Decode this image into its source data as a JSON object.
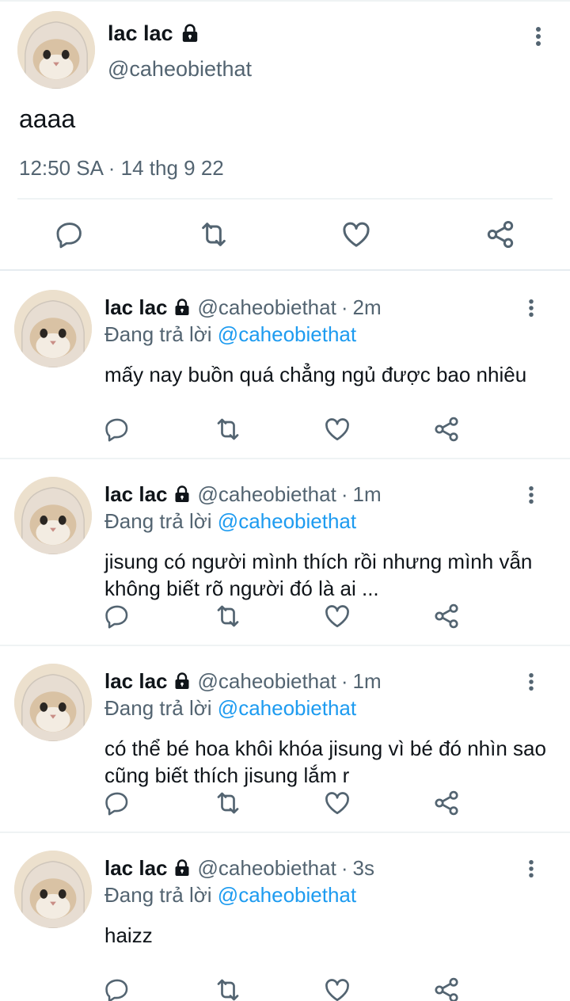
{
  "main_tweet": {
    "display_name": "lac lac",
    "handle": "@caheobiethat",
    "text": "aaaa",
    "timestamp": "12:50 SA · 14 thg 9 22",
    "icons": {
      "lock": "lock-icon",
      "more": "more-vertical-icon",
      "reply": "reply-icon",
      "retweet": "retweet-icon",
      "like": "like-icon",
      "share": "share-icon"
    }
  },
  "replies": [
    {
      "display_name": "lac lac",
      "handle": "@caheobiethat",
      "separator": "·",
      "age": "2m",
      "replying_prefix": "Đang trả lời",
      "replying_to": "@caheobiethat",
      "text": "mấy nay buồn quá chẳng ngủ được bao nhiêu"
    },
    {
      "display_name": "lac lac",
      "handle": "@caheobiethat",
      "separator": "·",
      "age": "1m",
      "replying_prefix": "Đang trả lời",
      "replying_to": "@caheobiethat",
      "text": "jisung có người mình thích rồi nhưng mình vẫn không biết rõ người đó là ai ..."
    },
    {
      "display_name": "lac lac",
      "handle": "@caheobiethat",
      "separator": "·",
      "age": "1m",
      "replying_prefix": "Đang trả lời",
      "replying_to": "@caheobiethat",
      "text": "có thể bé hoa khôi khóa jisung vì bé đó nhìn sao cũng biết thích jisung lắm r"
    },
    {
      "display_name": "lac lac",
      "handle": "@caheobiethat",
      "separator": "·",
      "age": "3s",
      "replying_prefix": "Đang trả lời",
      "replying_to": "@caheobiethat",
      "text": "haizz"
    }
  ],
  "colors": {
    "text": "#0f1419",
    "secondary": "#536471",
    "mention": "#1d9bf0",
    "divider": "#eff3f4"
  }
}
